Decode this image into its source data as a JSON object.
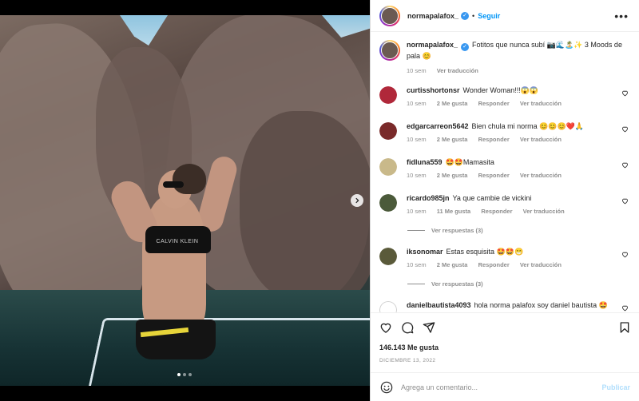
{
  "header": {
    "username": "normapalafox_",
    "separator": "•",
    "follow_label": "Seguir",
    "more_label": "•••"
  },
  "photo": {
    "brand_text": "CALVIN KLEIN",
    "carousel_total": 3,
    "carousel_active": 1
  },
  "caption": {
    "username": "normapalafox_",
    "text": "Fotitos que nunca subí 📷🌊🏝️✨ 3 Moods de pala 😊",
    "time": "10 sem",
    "translate": "Ver traducción"
  },
  "comments": [
    {
      "user": "curtisshortonsr",
      "text": "Wonder Woman!!!😱😱",
      "time": "10 sem",
      "likes": "2 Me gusta",
      "reply": "Responder",
      "translate": "Ver traducción",
      "avatar_color": "#b0283a"
    },
    {
      "user": "edgarcarreon5642",
      "text": "Bien chula mi norma 😊😊😊❤️🙏",
      "time": "10 sem",
      "likes": "2 Me gusta",
      "reply": "Responder",
      "translate": "Ver traducción",
      "avatar_color": "#7a2a2a"
    },
    {
      "user": "fidluna559",
      "text": "🤩🤩Mamasita",
      "time": "10 sem",
      "likes": "2 Me gusta",
      "reply": "Responder",
      "translate": "Ver traducción",
      "avatar_color": "#c9b98a"
    },
    {
      "user": "ricardo985jn",
      "text": "Ya que cambie de vickini",
      "time": "10 sem",
      "likes": "11 Me gusta",
      "reply": "Responder",
      "translate": "Ver traducción",
      "avatar_color": "#4b5a3a",
      "replies": "Ver respuestas (3)"
    },
    {
      "user": "iksonomar",
      "text": "Estas esquisita 🤩🤩😁",
      "time": "10 sem",
      "likes": "2 Me gusta",
      "reply": "Responder",
      "translate": "Ver traducción",
      "avatar_color": "#5a5a3a",
      "replies": "Ver respuestas (3)"
    },
    {
      "user": "danielbautista4093",
      "text": "hola norma palafox soy daniel bautista 🤩",
      "avatar_color": "#d8d8d8"
    }
  ],
  "actions": {
    "likes": "146.143 Me gusta",
    "date": "DICIEMBRE 13, 2022"
  },
  "add_comment": {
    "placeholder": "Agrega un comentario...",
    "publish": "Publicar"
  },
  "colors": {
    "link_blue": "#0095f6",
    "publish_disabled": "#b2dffc",
    "muted": "#8e8e8e",
    "verified": "#3897f0"
  }
}
